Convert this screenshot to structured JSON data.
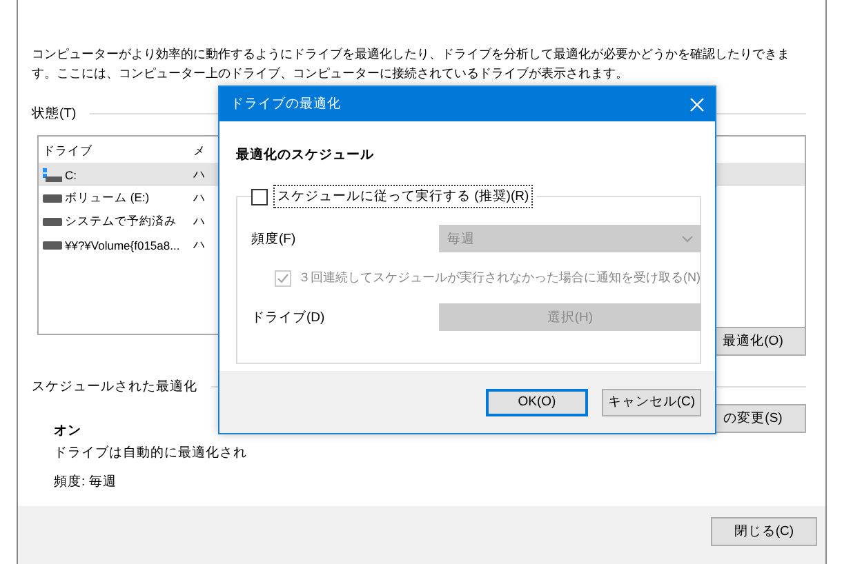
{
  "window": {
    "description": "コンピューターがより効率的に動作するようにドライブを最適化したり、ドライブを分析して最適化が必要かどうかを確認したりできます。ここには、コンピューター上のドライブ、コンピューターに接続されているドライブが表示されます。"
  },
  "status": {
    "title": "状態(T)",
    "columns": [
      "ドライブ",
      "メ"
    ],
    "rows": [
      {
        "drive": "C:",
        "media": "ハ",
        "kind": "system",
        "selected": true
      },
      {
        "drive": "ボリューム (E:)",
        "media": "ハ",
        "kind": "disk",
        "selected": false
      },
      {
        "drive": "システムで予約済み",
        "media": "ハ",
        "kind": "disk",
        "selected": false
      },
      {
        "drive": "¥¥?¥Volume{f015a8...",
        "media": "ハ",
        "kind": "disk",
        "selected": false
      }
    ],
    "optimize_button": "最適化(O)"
  },
  "scheduled": {
    "title": "スケジュールされた最適化",
    "state": "オン",
    "message": "ドライブは自動的に最適化され",
    "frequency": "頻度: 毎週",
    "change_button": "の変更(S)"
  },
  "close_button": "閉じる(C)",
  "dialog": {
    "title": "ドライブの最適化",
    "heading": "最適化のスケジュール",
    "run_on_schedule": {
      "label": "スケジュールに従って実行する (推奨)(R)",
      "checked": false
    },
    "frequency_label": "頻度(F)",
    "frequency": {
      "value": "毎週",
      "disabled": true
    },
    "notify": {
      "label": "３回連続してスケジュールが実行されなかった場合に通知を受け取る(N)",
      "checked": true,
      "disabled": true
    },
    "drive_label": "ドライブ(D)",
    "select_button": {
      "label": "選択(H)",
      "disabled": true
    },
    "buttons": [
      {
        "label": "OK(O)",
        "default": true
      },
      {
        "label": "キャンセル(C)",
        "default": false
      }
    ]
  }
}
